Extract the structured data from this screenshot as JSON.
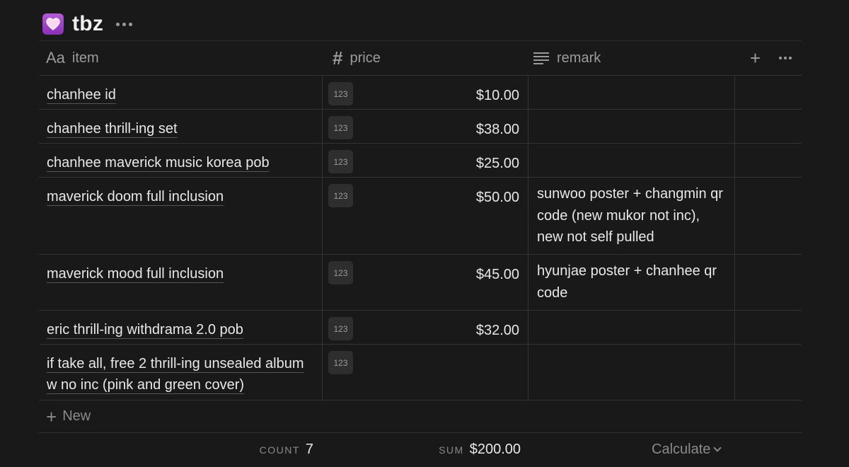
{
  "page": {
    "icon": "heart-icon",
    "title": "tbz"
  },
  "columns": {
    "item": {
      "icon": "Aa",
      "label": "item"
    },
    "price": {
      "icon": "#",
      "label": "price"
    },
    "remark": {
      "icon": "list-icon",
      "label": "remark"
    }
  },
  "rows": [
    {
      "item": "chanhee id",
      "badge": "123",
      "price": "$10.00",
      "remark": ""
    },
    {
      "item": "chanhee thrill-ing set",
      "badge": "123",
      "price": "$38.00",
      "remark": ""
    },
    {
      "item": "chanhee maverick music korea pob",
      "badge": "123",
      "price": "$25.00",
      "remark": ""
    },
    {
      "item": "maverick doom full inclusion",
      "badge": "123",
      "price": "$50.00",
      "remark": "sunwoo poster + changmin qr code (new mukor not inc), new not self pulled"
    },
    {
      "item": "maverick mood full inclusion",
      "badge": "123",
      "price": "$45.00",
      "remark": "hyunjae poster + chanhee qr code"
    },
    {
      "item": "eric thrill-ing withdrama 2.0 pob",
      "badge": "123",
      "price": "$32.00",
      "remark": ""
    },
    {
      "item": "if take all, free 2 thrill-ing unsealed album w no inc (pink and green cover)",
      "badge": "123",
      "price": "",
      "remark": ""
    }
  ],
  "new_label": "New",
  "footer": {
    "count_label": "COUNT",
    "count_value": "7",
    "sum_label": "SUM",
    "sum_value": "$200.00",
    "calculate_label": "Calculate"
  },
  "colors": {
    "background": "#191919",
    "text": "#e8e8e8",
    "muted": "#9b9b9b",
    "border": "#333333",
    "icon_accent": "#a84fd0"
  }
}
